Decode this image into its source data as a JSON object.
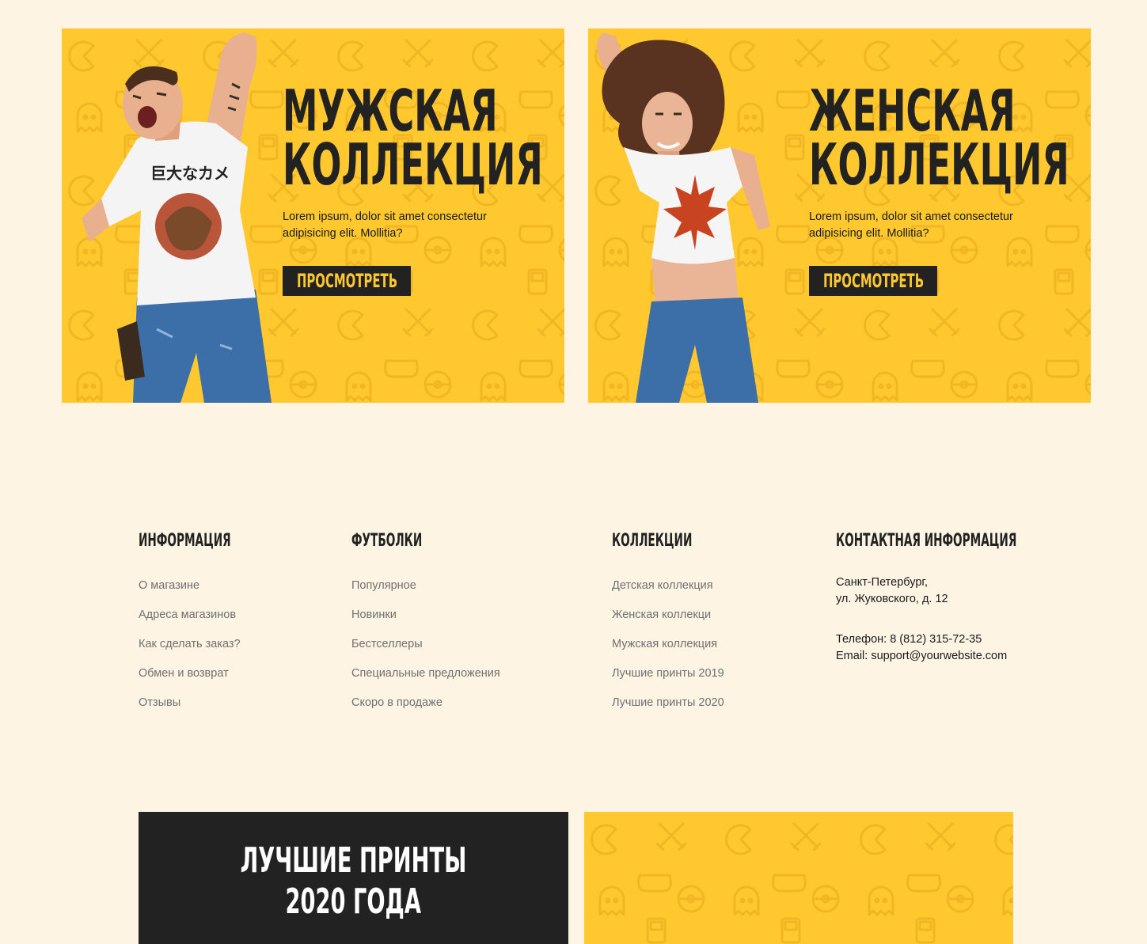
{
  "banners": [
    {
      "title_line1": "МУЖСКАЯ",
      "title_line2": "КОЛЛЕКЦИЯ",
      "description": "Lorem ipsum, dolor sit amet consectetur adipisicing elit. Mollitia?",
      "button": "ПРОСМОТРЕТЬ"
    },
    {
      "title_line1": "ЖЕНСКАЯ",
      "title_line2": "КОЛЛЕКЦИЯ",
      "description": "Lorem ipsum, dolor sit amet consectetur adipisicing elit. Mollitia?",
      "button": "ПРОСМОТРЕТЬ"
    }
  ],
  "footer": {
    "info": {
      "heading": "ИНФОРМАЦИЯ",
      "links": [
        "О магазине",
        "Адреса магазинов",
        "Как сделать заказ?",
        "Обмен и возврат",
        "Отзывы"
      ]
    },
    "tshirts": {
      "heading": "ФУТБОЛКИ",
      "links": [
        "Популярное",
        "Новинки",
        "Бестселлеры",
        "Специальные предложения",
        "Скоро в продаже"
      ]
    },
    "collections": {
      "heading": "КОЛЛЕКЦИИ",
      "links": [
        "Детская коллекция",
        "Женская коллекци",
        "Мужская коллекция",
        "Лучшие принты 2019",
        "Лучшие принты 2020"
      ]
    },
    "contacts": {
      "heading": "КОНТАКТНАЯ ИНФОРМАЦИЯ",
      "address_line1": "Санкт-Петербург,",
      "address_line2": "ул. Жуковского, д. 12",
      "phone": "Телефон: 8 (812) 315-72-35",
      "email": "Email: support@yourwebsite.com"
    }
  },
  "promo": {
    "title_line1": "ЛУЧШИЕ ПРИНТЫ",
    "title_line2": "2020 ГОДА"
  },
  "colors": {
    "background": "#fdf4e4",
    "accent_yellow": "#ffc82f",
    "dark": "#222222",
    "link_gray": "#707070"
  }
}
